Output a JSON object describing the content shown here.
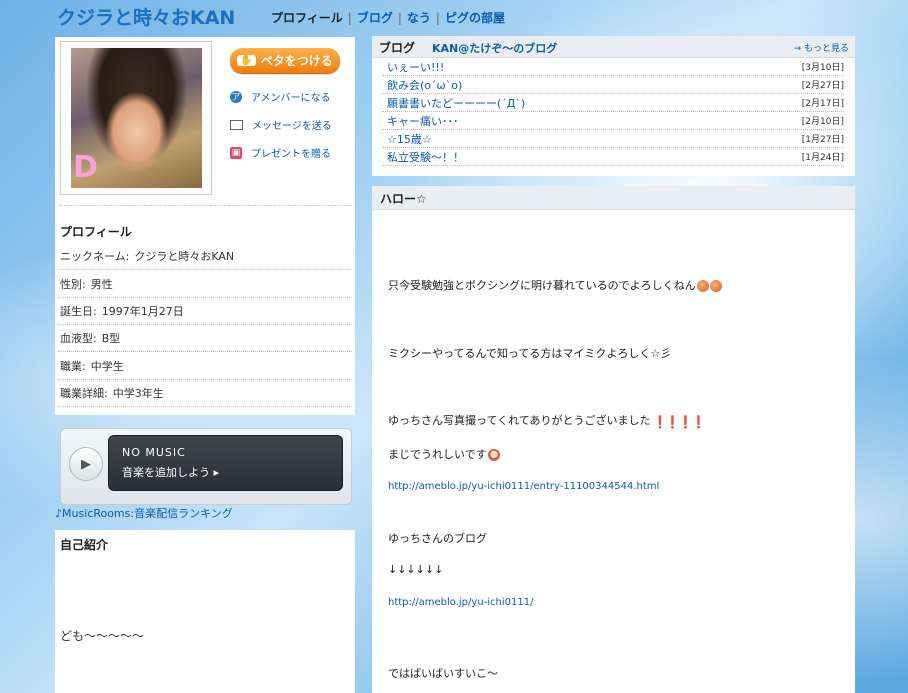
{
  "header": {
    "site_title": "クジラと時々おKAN",
    "nav": [
      "プロフィール",
      "ブログ",
      "なう",
      "ピグの部屋"
    ],
    "separator": "|"
  },
  "profile_card": {
    "photo_letter": "D",
    "peta_button": "ペタをつける",
    "peta_icon": "hand-icon",
    "actions": [
      {
        "label": "アメンバーになる",
        "icon": "amember-icon"
      },
      {
        "label": "メッセージを送る",
        "icon": "mail-icon"
      },
      {
        "label": "プレゼントを贈る",
        "icon": "gift-icon"
      }
    ],
    "heading": "プロフィール",
    "rows": [
      {
        "key": "ニックネーム:",
        "value": "クジラと時々おKAN"
      },
      {
        "key": "性別:",
        "value": "男性"
      },
      {
        "key": "誕生日:",
        "value": "1997年1月27日"
      },
      {
        "key": "血液型:",
        "value": "B型"
      },
      {
        "key": "職業:",
        "value": "中学生"
      },
      {
        "key": "職業詳細:",
        "value": "中学3年生"
      }
    ]
  },
  "music_player": {
    "status": "NO MUSIC",
    "add_label": "音楽を追加しよう",
    "link": "♪MusicRooms:音楽配信ランキング"
  },
  "intro": {
    "heading": "自己紹介",
    "text": "ども〜〜〜〜〜"
  },
  "blog": {
    "heading": "ブログ",
    "blog_name": "KAN@たけぞ〜のブログ",
    "more": "→ もっと見る",
    "entries": [
      {
        "title": "いぇーい!!!",
        "date": "[3月10日]"
      },
      {
        "title": "飲み会(o´ω`o)",
        "date": "[2月27日]"
      },
      {
        "title": "願書書いたどーーーー(´Д`)",
        "date": "[2月17日]"
      },
      {
        "title": "キャー痛い･･･",
        "date": "[2月10日]"
      },
      {
        "title": "☆15歳☆",
        "date": "[1月27日]"
      },
      {
        "title": "私立受験〜！！",
        "date": "[1月24日]"
      }
    ]
  },
  "entry": {
    "title": "ハロー☆",
    "line1": "只今受験勉強とボクシングに明け暮れているのでよろしくねん",
    "line2": "ミクシーやってるんで知ってる方はマイミクよろしく☆彡",
    "line3": "ゆっちさん写真撮ってくれてありがとうございました",
    "line3_emoji": "❗❗❗❗",
    "line4": "まじでうれしいです",
    "link1": "http://ameblo.jp/yu-ichi0111/entry-11100344544.html",
    "line5": "ゆっちさんのブログ",
    "arrows": "↓↓↓↓↓↓",
    "link2": "http://ameblo.jp/yu-ichi0111/",
    "line6": "ではばいばいすいこ〜"
  }
}
